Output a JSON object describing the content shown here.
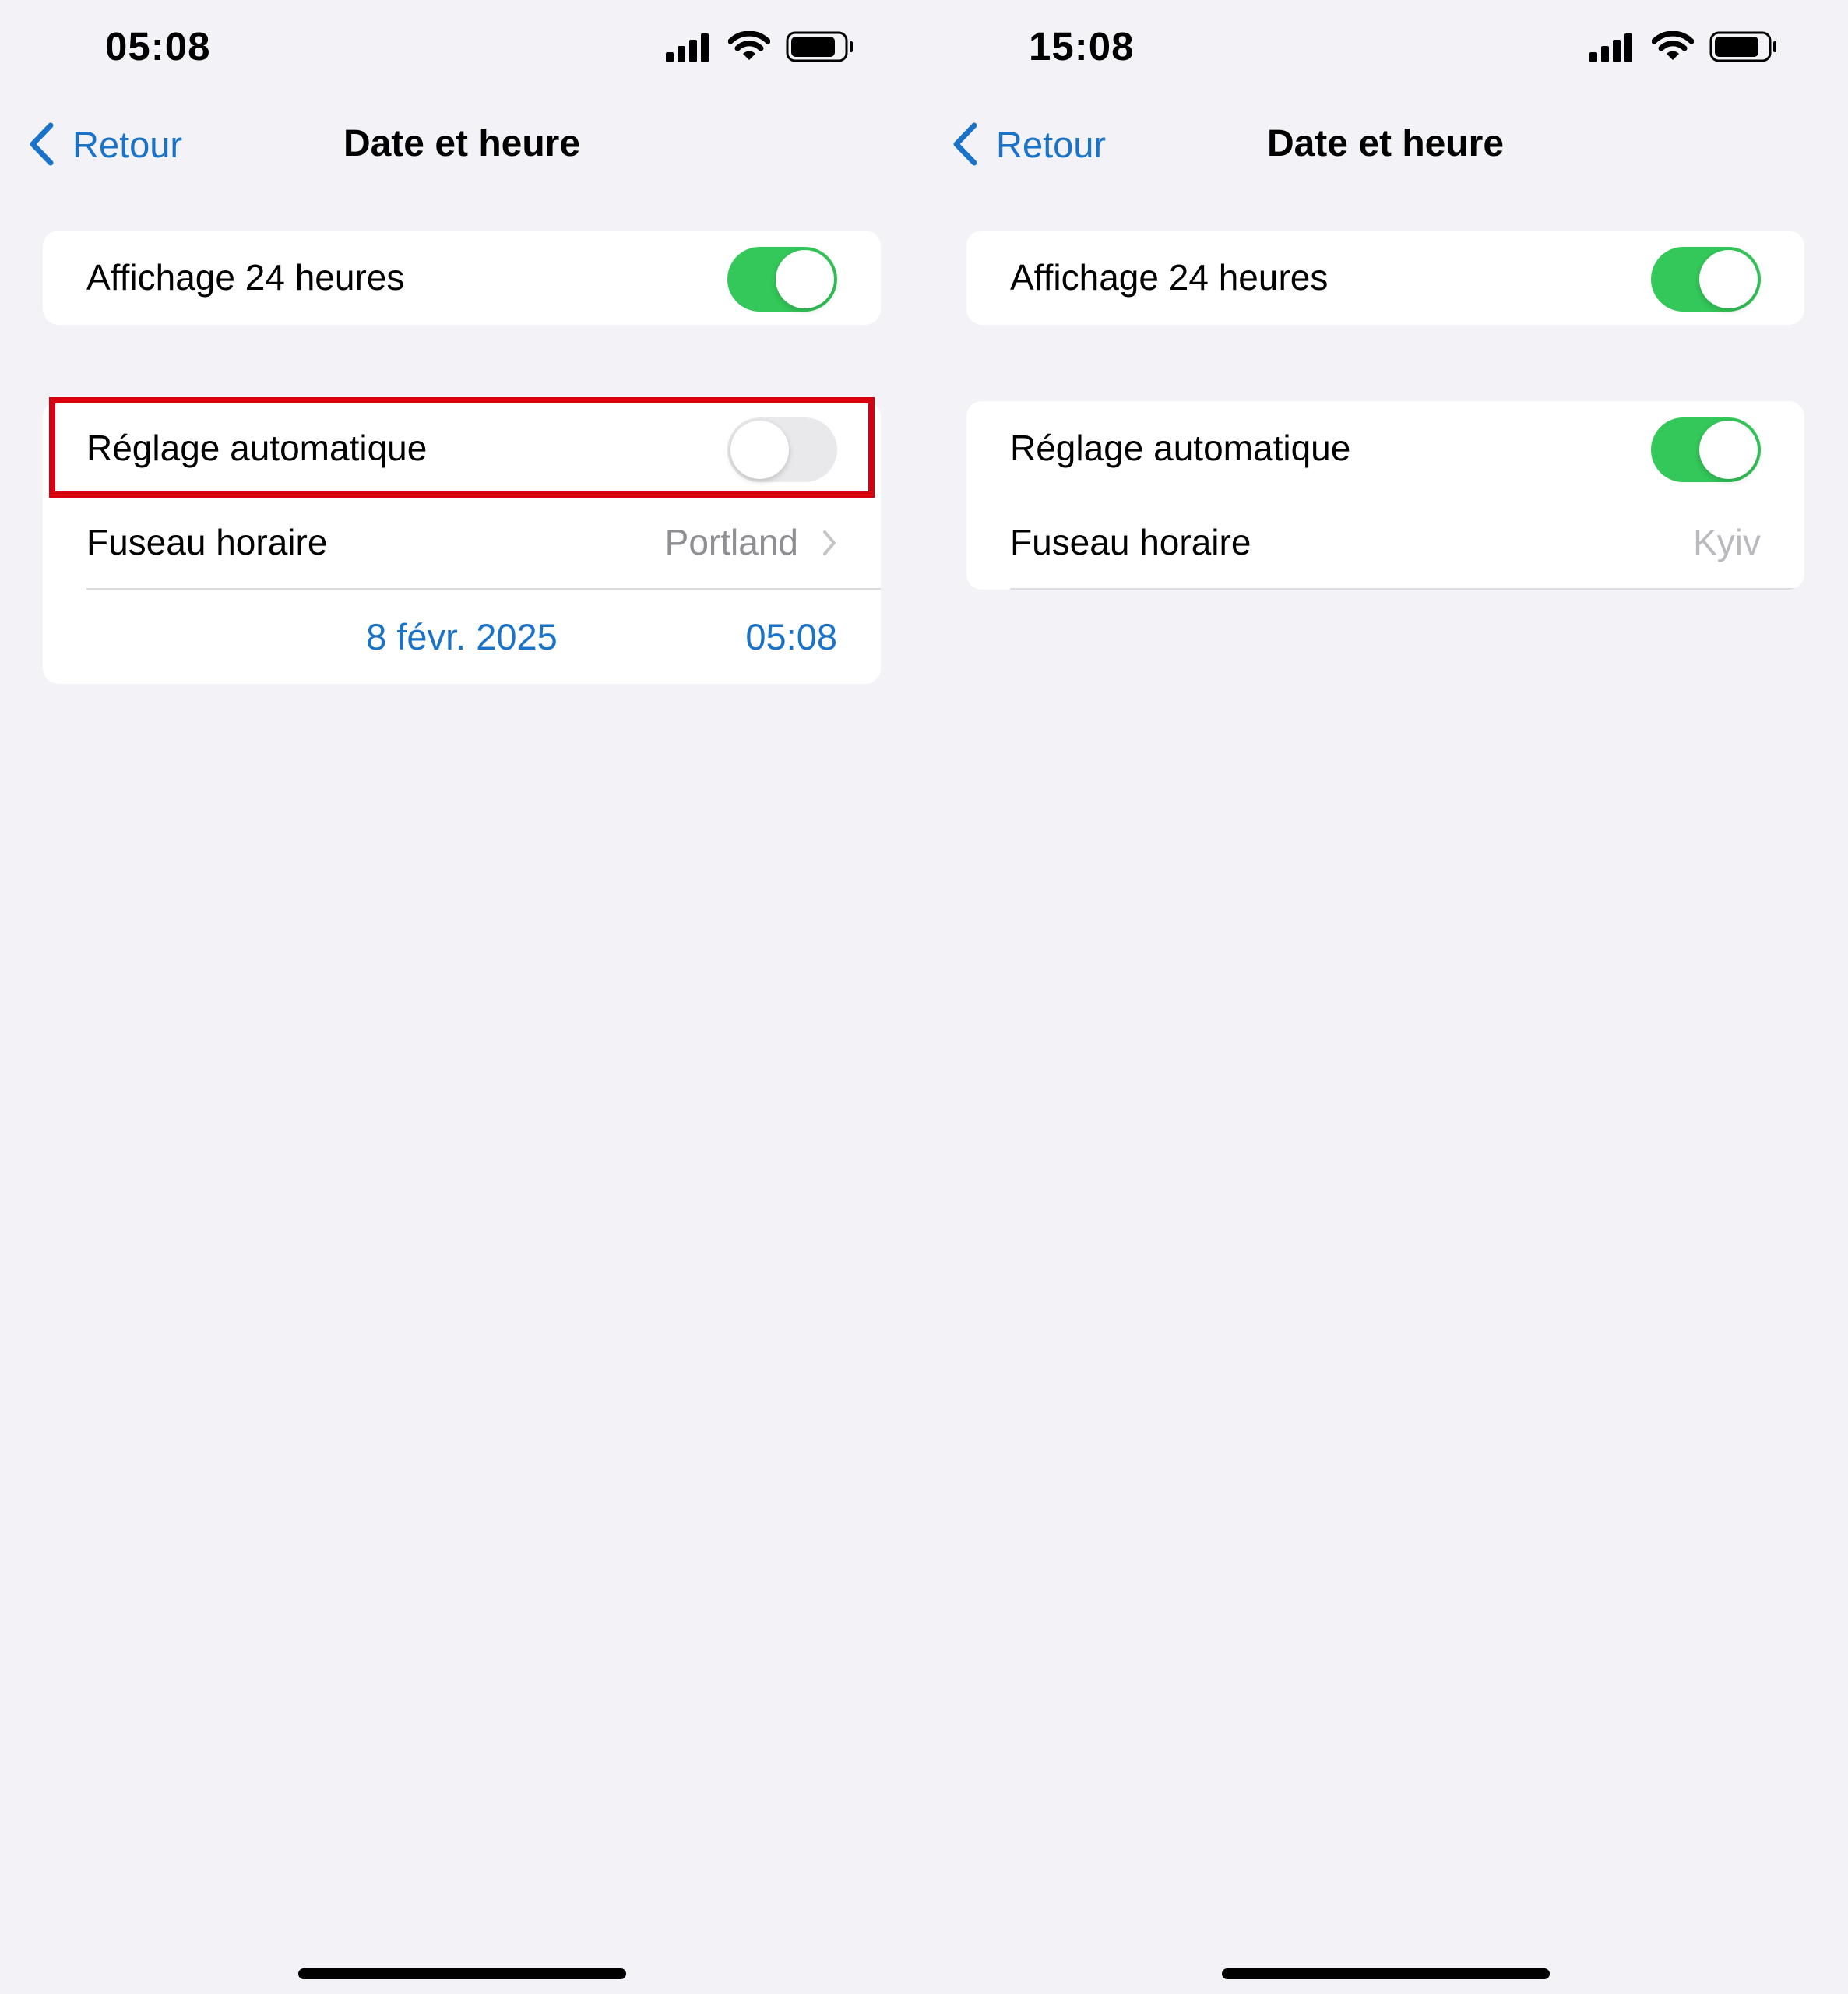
{
  "screens": [
    {
      "status_time": "05:08",
      "nav": {
        "back_label": "Retour",
        "title": "Date et heure"
      },
      "display_24h": {
        "label": "Affichage 24 heures",
        "on": true
      },
      "auto_set": {
        "label": "Réglage automatique",
        "on": false,
        "highlighted": true
      },
      "timezone": {
        "label": "Fuseau horaire",
        "value": "Portland"
      },
      "date_value": "8 févr. 2025",
      "time_value": "05:08"
    },
    {
      "status_time": "15:08",
      "nav": {
        "back_label": "Retour",
        "title": "Date et heure"
      },
      "display_24h": {
        "label": "Affichage 24 heures",
        "on": true
      },
      "auto_set": {
        "label": "Réglage automatique",
        "on": true,
        "highlighted": false
      },
      "timezone": {
        "label": "Fuseau horaire",
        "value": "Kyiv"
      }
    }
  ],
  "colors": {
    "accent_blue": "#1a73c8",
    "toggle_on": "#34c759",
    "toggle_off": "#e9e9eb",
    "highlight_red": "#d7000f",
    "background": "#f2f2f7"
  },
  "icons": [
    "signal-icon",
    "wifi-icon",
    "battery-icon",
    "chevron-left-icon",
    "chevron-right-icon"
  ]
}
